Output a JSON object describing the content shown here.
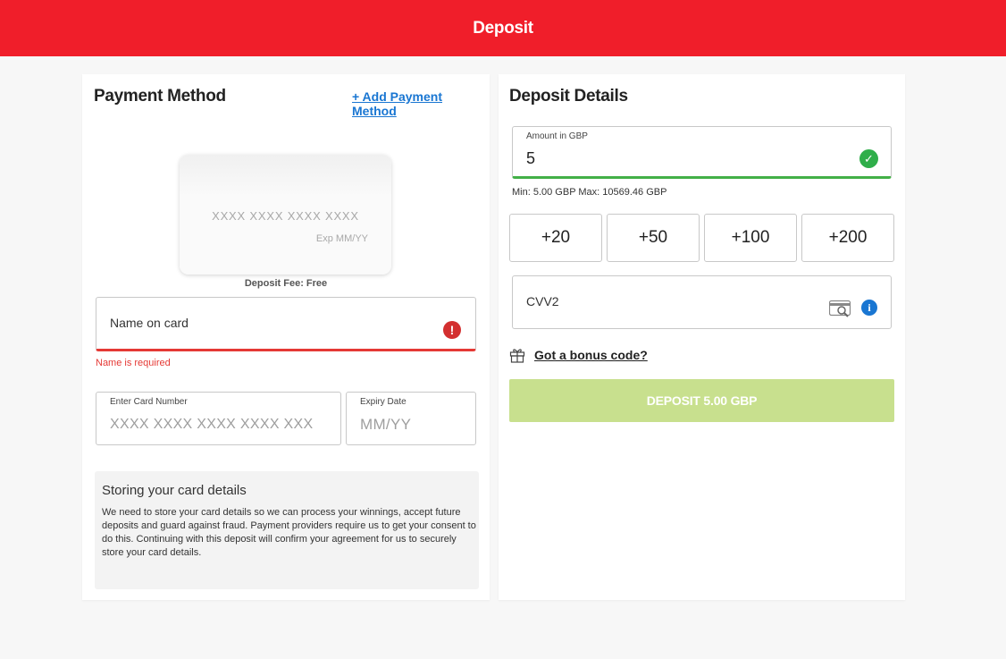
{
  "header": {
    "title": "Deposit"
  },
  "payment_method": {
    "heading": "Payment Method",
    "add_link": "+ Add Payment Method",
    "card_preview": {
      "number_placeholder": "XXXX XXXX XXXX XXXX",
      "exp_placeholder": "Exp MM/YY"
    },
    "deposit_fee": "Deposit Fee: Free",
    "name_field": {
      "label": "Name on card",
      "error": "Name is required",
      "error_icon": "alert-icon"
    },
    "card_number": {
      "label": "Enter Card Number",
      "placeholder": "XXXX XXXX XXXX XXXX XXX"
    },
    "expiry": {
      "label": "Expiry Date",
      "placeholder": "MM/YY"
    },
    "storing": {
      "title": "Storing your card details",
      "body": "We need to store your card details so we can process your winnings, accept future deposits and guard against fraud. Payment providers require us to get your consent to do this. Continuing with this deposit will confirm your agreement for us to securely store your card details."
    }
  },
  "deposit_details": {
    "heading": "Deposit Details",
    "amount": {
      "label": "Amount in GBP",
      "value": "5",
      "valid_icon": "check-icon"
    },
    "limits": "Min: 5.00 GBP Max: 10569.46 GBP",
    "quick_amounts": [
      "+20",
      "+50",
      "+100",
      "+200"
    ],
    "cvv": {
      "label": "CVV2",
      "icons": [
        "card-security-icon",
        "info-icon"
      ]
    },
    "bonus_link": "Got a bonus code?",
    "deposit_button": "DEPOSIT 5.00 GBP"
  },
  "colors": {
    "brand_red": "#f01e2a",
    "link_blue": "#1976d2",
    "success_green": "#43b047",
    "error_red": "#e53935",
    "disabled_button": "#c8e08e"
  }
}
